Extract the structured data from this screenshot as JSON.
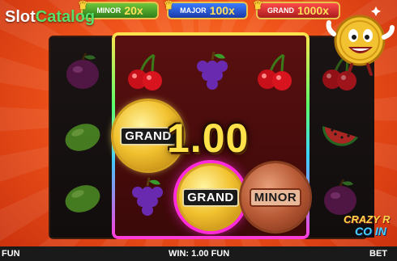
{
  "watermark": {
    "part1": "Slot",
    "part2": "Catalog"
  },
  "jackpots": [
    {
      "name": "MINOR",
      "multiplier": "20x",
      "color": "#2f7d1c"
    },
    {
      "name": "MAJOR",
      "multiplier": "100x",
      "color": "#1c3aa8"
    },
    {
      "name": "GRAND",
      "multiplier": "1000x",
      "color": "#a81c1c"
    }
  ],
  "reels": {
    "reel1": [
      "plum",
      "lime",
      "lime"
    ],
    "reel2": [
      "cherry",
      "coin-grand",
      "grapes"
    ],
    "reel3": [
      "grapes",
      "win-text",
      "coin-grand"
    ],
    "reel4": [
      "cherry",
      "",
      "coin-minor"
    ],
    "reel5": [
      "cherry",
      "watermelon",
      "plum"
    ]
  },
  "coins": [
    {
      "label": "GRAND",
      "style": "gold"
    },
    {
      "label": "GRAND",
      "style": "gold-highlight"
    },
    {
      "label": "MINOR",
      "style": "bronze"
    }
  ],
  "win_display": "1.00",
  "logo": {
    "line1": "CRAZY R",
    "line2": "CO IN"
  },
  "bottom_bar": {
    "left": "FUN",
    "center": "WIN: 1.00 FUN",
    "right": "BET"
  },
  "colors": {
    "background": "#f0531a",
    "win_text": "#ffe24a",
    "highlight": "#ff2ad9"
  },
  "icons": [
    "cherry-icon",
    "grapes-icon",
    "plum-icon",
    "lime-icon",
    "watermelon-icon",
    "mascot-coin-icon"
  ]
}
